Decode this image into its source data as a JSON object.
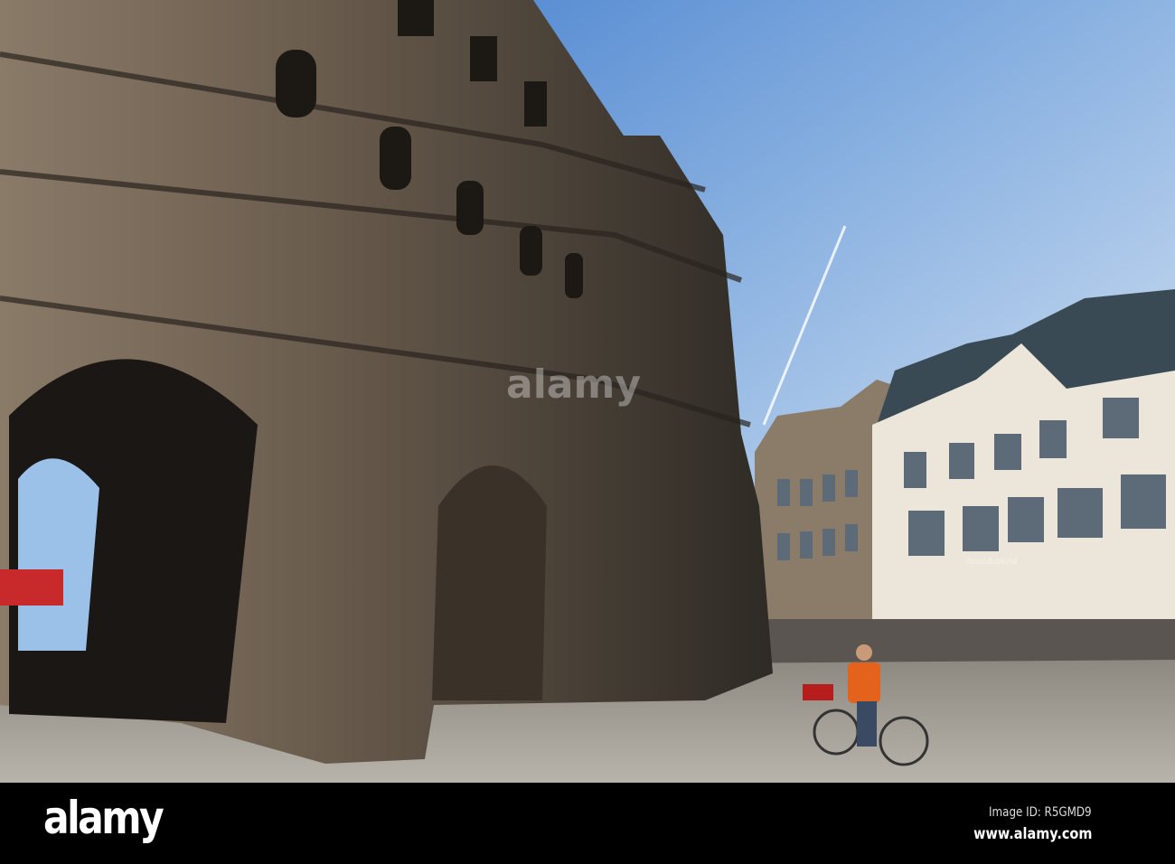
{
  "photo": {
    "subject": "Porta Nigra",
    "shop_sign": "dean&david",
    "watermark": "alamy"
  },
  "footer": {
    "logo": "alamy",
    "image_id": "Image ID: R5GMD9",
    "url": "www.alamy.com"
  },
  "colors": {
    "sky_top": "#3f7fd0",
    "sky_light": "#e8f0f8",
    "stone_dark": "#3a342d",
    "stone_light": "#a89580",
    "building_white": "#ece6da",
    "ground": "#a9a49c",
    "bar": "#000000"
  }
}
